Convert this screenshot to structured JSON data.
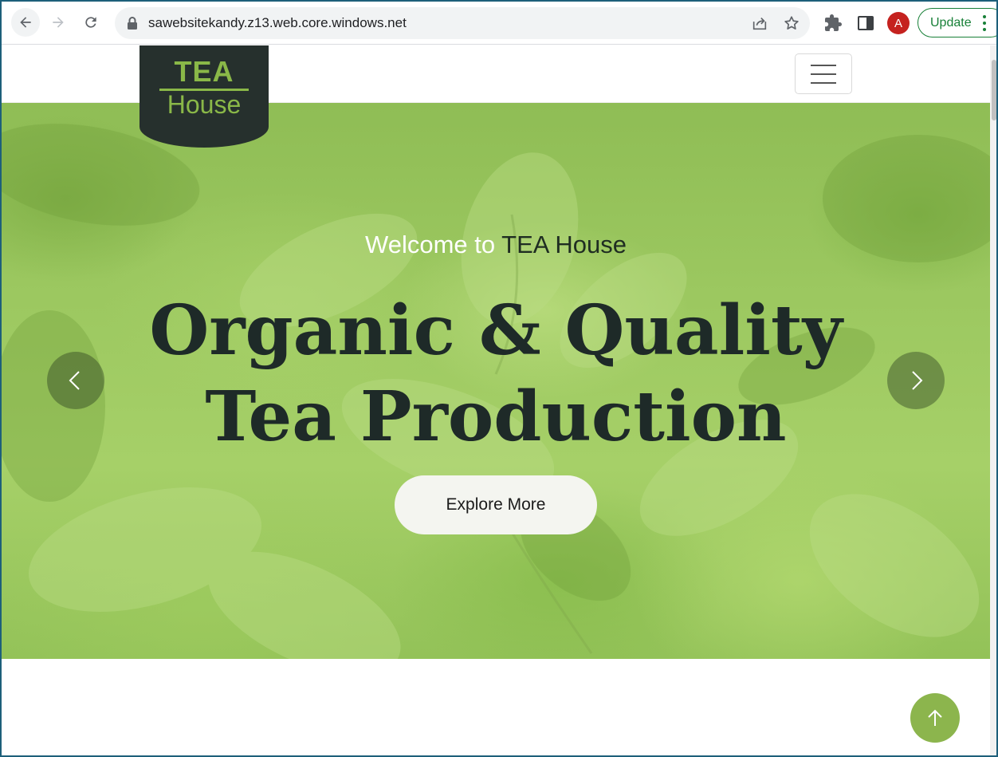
{
  "browser": {
    "url": "sawebsitekandy.z13.web.core.windows.net",
    "profile_initial": "A",
    "update_label": "Update",
    "icons": [
      "back-icon",
      "forward-icon",
      "reload-icon",
      "lock-icon",
      "share-icon",
      "star-icon",
      "extensions-icon",
      "side-panel-icon",
      "kebab-menu-icon"
    ],
    "colors": {
      "profile_avatar": "#c5221f",
      "update_accent": "#188038"
    }
  },
  "site": {
    "logo": {
      "top": "TEA",
      "bottom": "House"
    },
    "hero": {
      "welcome_prefix": "Welcome to ",
      "welcome_brand": "TEA House",
      "title_line1": "Organic & Quality",
      "title_line2": "Tea Production",
      "cta_label": "Explore More"
    },
    "icons": [
      "hamburger-menu-icon",
      "chevron-left-icon",
      "chevron-right-icon",
      "arrow-up-icon"
    ],
    "colors": {
      "logo_bg": "#26302d",
      "logo_accent": "#8ab848",
      "title": "#1e2a28",
      "back_to_top": "#8cb54d"
    }
  }
}
